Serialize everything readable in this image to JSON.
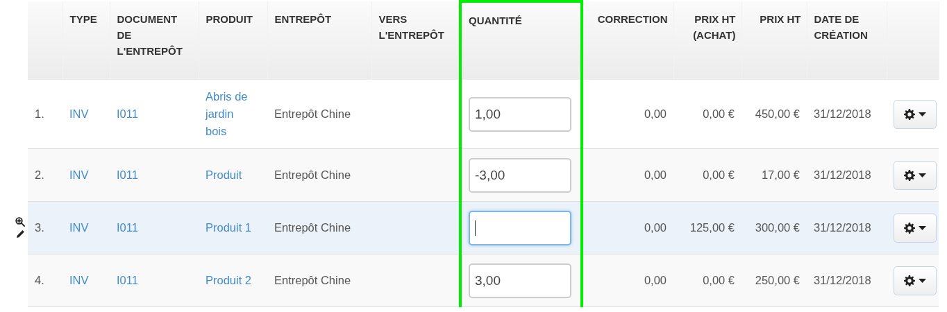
{
  "columns": [
    {
      "highlighted": false
    },
    {
      "label": "TYPE",
      "highlighted": false
    },
    {
      "label": "DOCUMENT DE L'ENTREPÔT",
      "highlighted": false
    },
    {
      "label": "PRODUIT",
      "highlighted": false
    },
    {
      "label": "ENTREPÔT",
      "highlighted": false
    },
    {
      "label": "VERS L'ENTREPÔT",
      "highlighted": false
    },
    {
      "label": "QUANTITÉ",
      "highlighted": true
    },
    {
      "label": "CORRECTION",
      "highlighted": false
    },
    {
      "label": "PRIX HT (ACHAT)",
      "highlighted": false
    },
    {
      "label": "PRIX HT",
      "highlighted": false
    },
    {
      "label": "DATE DE CRÉATION",
      "highlighted": false
    },
    {
      "highlighted": false
    }
  ],
  "rows": [
    {
      "number": "1.",
      "type": "INV",
      "document": "I011",
      "product": "Abris de jardin bois",
      "warehouse": "Entrepôt Chine",
      "quantity": "1,00",
      "focused": false,
      "selected": false,
      "correction": "0,00",
      "purchase_price": "0,00 €",
      "price": "450,00 €",
      "created": "31/12/2018"
    },
    {
      "number": "2.",
      "type": "INV",
      "document": "I011",
      "product": "Produit",
      "warehouse": "Entrepôt Chine",
      "quantity": "-3,00",
      "focused": false,
      "selected": false,
      "correction": "0,00",
      "purchase_price": "0,00 €",
      "price": "17,00 €",
      "created": "31/12/2018"
    },
    {
      "number": "3.",
      "type": "INV",
      "document": "I011",
      "product": "Produit 1",
      "warehouse": "Entrepôt Chine",
      "quantity": "",
      "focused": true,
      "selected": true,
      "correction": "0,00",
      "purchase_price": "125,00 €",
      "price": "300,00 €",
      "created": "31/12/2018"
    },
    {
      "number": "4.",
      "type": "INV",
      "document": "I011",
      "product": "Produit 2",
      "warehouse": "Entrepôt Chine",
      "quantity": "3,00",
      "focused": false,
      "selected": false,
      "correction": "0,00",
      "purchase_price": "0,00 €",
      "price": "250,00 €",
      "created": "31/12/2018"
    }
  ]
}
